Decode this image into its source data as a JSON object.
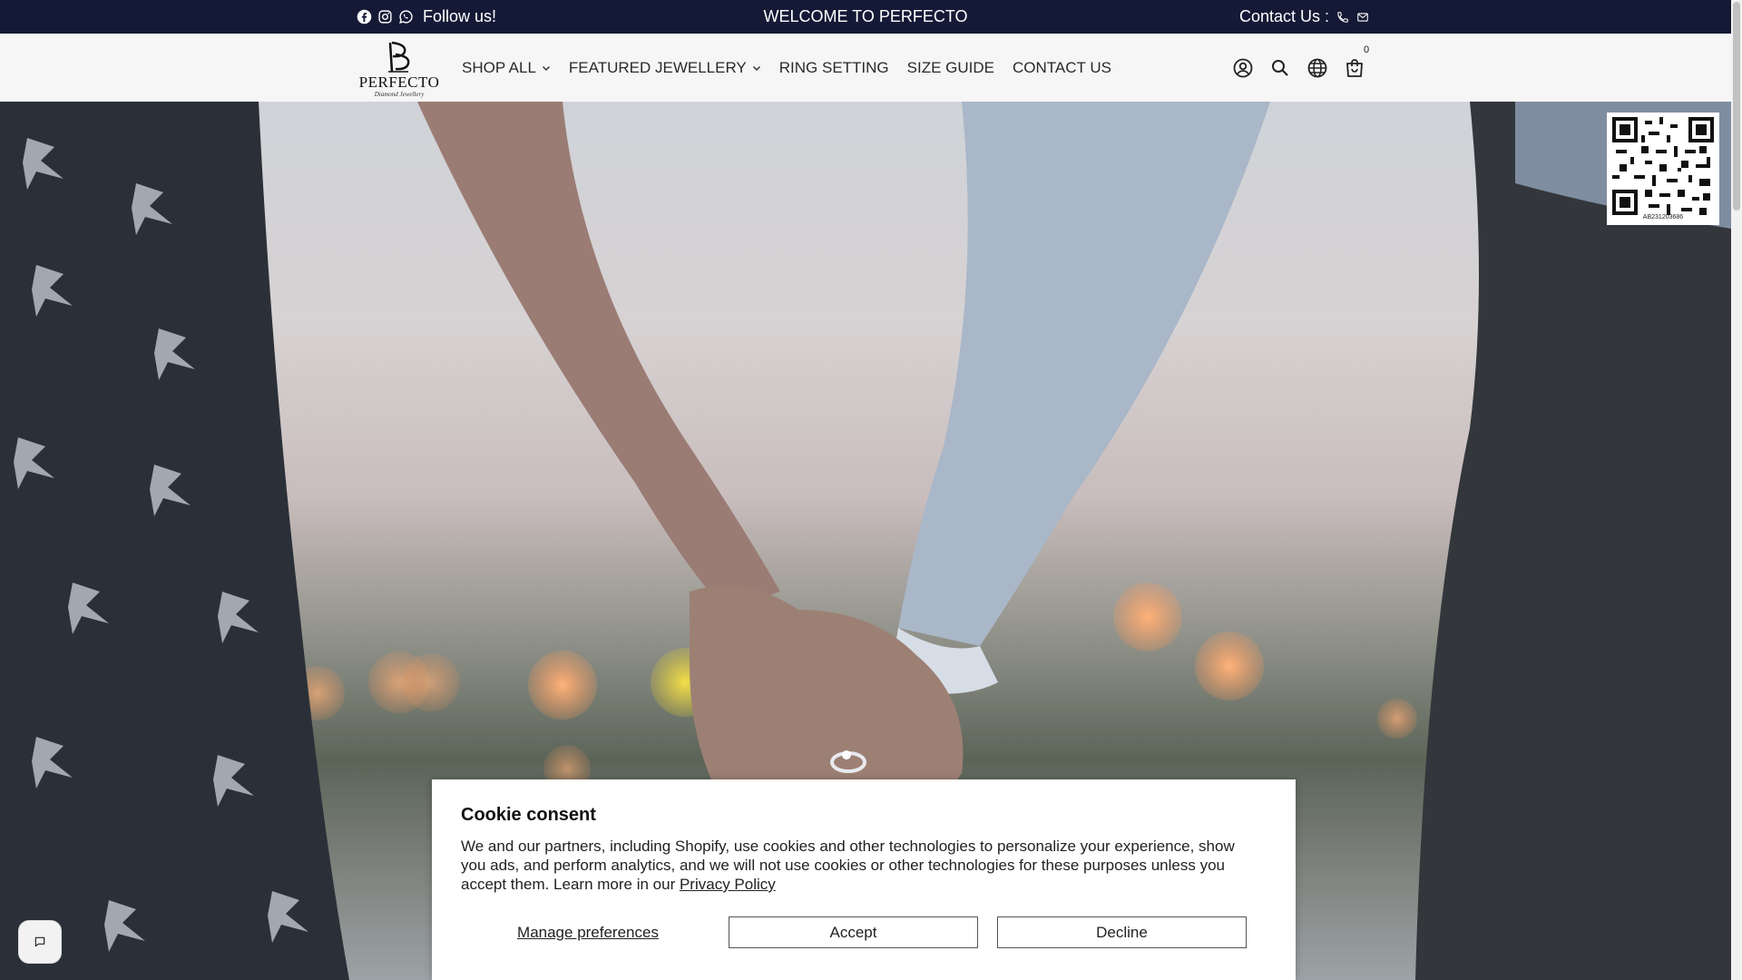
{
  "announcement": {
    "follow_label": "Follow us!",
    "welcome": "WELCOME TO PERFECTO",
    "contact_label": "Contact Us :"
  },
  "header": {
    "logo_name": "PERFECTO",
    "logo_tagline": "Diamond Jewellery",
    "nav": [
      {
        "label": "SHOP ALL",
        "dropdown": true
      },
      {
        "label": "FEATURED JEWELLERY",
        "dropdown": true
      },
      {
        "label": "RING SETTING",
        "dropdown": false
      },
      {
        "label": "SIZE GUIDE",
        "dropdown": false
      },
      {
        "label": "CONTACT US",
        "dropdown": false
      }
    ],
    "cart_count": "0"
  },
  "qr": {
    "caption": "AB231203686"
  },
  "cookie": {
    "title": "Cookie consent",
    "message": "We and our partners, including Shopify, use cookies and other technologies to personalize your experience, show you ads, and perform analytics, and we will not use cookies or other technologies for these purposes unless you accept them. Learn more in our",
    "privacy_link": "Privacy Policy",
    "manage_label": "Manage preferences",
    "accept_label": "Accept",
    "decline_label": "Decline"
  },
  "colors": {
    "topbar_bg": "#141a36",
    "header_bg": "#f6f6f6"
  }
}
